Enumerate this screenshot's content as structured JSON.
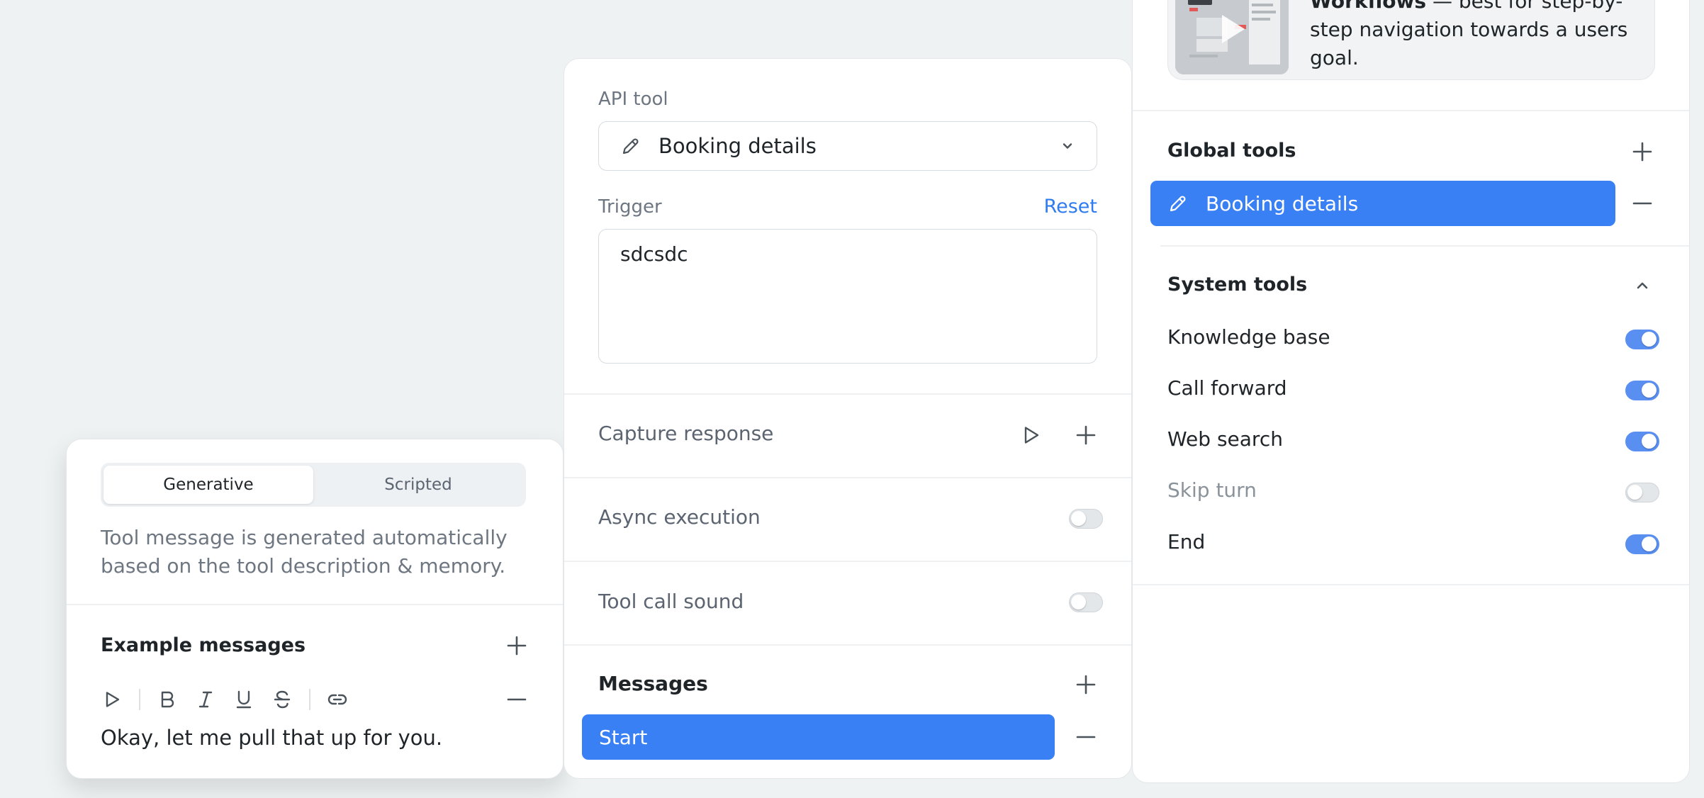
{
  "left_panel": {
    "segments": [
      "Generative",
      "Scripted"
    ],
    "active_segment": "Generative",
    "description": "Tool message is generated automatically based on the tool description & memory.",
    "example_heading": "Example messages",
    "example_message": "Okay, let me pull that up for you."
  },
  "middle_panel": {
    "api_tool_label": "API tool",
    "api_tool_value": "Booking details",
    "trigger_label": "Trigger",
    "reset_label": "Reset",
    "trigger_value": "sdcsdc",
    "capture_response_label": "Capture response",
    "async_execution_label": "Async execution",
    "async_execution_on": false,
    "tool_call_sound_label": "Tool call sound",
    "tool_call_sound_on": false,
    "messages_heading": "Messages",
    "messages_item": "Start"
  },
  "right_panel": {
    "video_title": "Workflows",
    "video_text": "— best for step-by-step navigation towards a users goal.",
    "global_tools_heading": "Global tools",
    "global_tool_item": "Booking details",
    "system_tools_heading": "System tools",
    "system_tools": [
      {
        "label": "Knowledge base",
        "on": true
      },
      {
        "label": "Call forward",
        "on": true
      },
      {
        "label": "Web search",
        "on": true
      },
      {
        "label": "Skip turn",
        "on": false
      },
      {
        "label": "End",
        "on": true
      }
    ]
  },
  "colors": {
    "accent": "#3a80f5",
    "toggle_on": "#5a8ff2",
    "link": "#2f7cf0"
  }
}
